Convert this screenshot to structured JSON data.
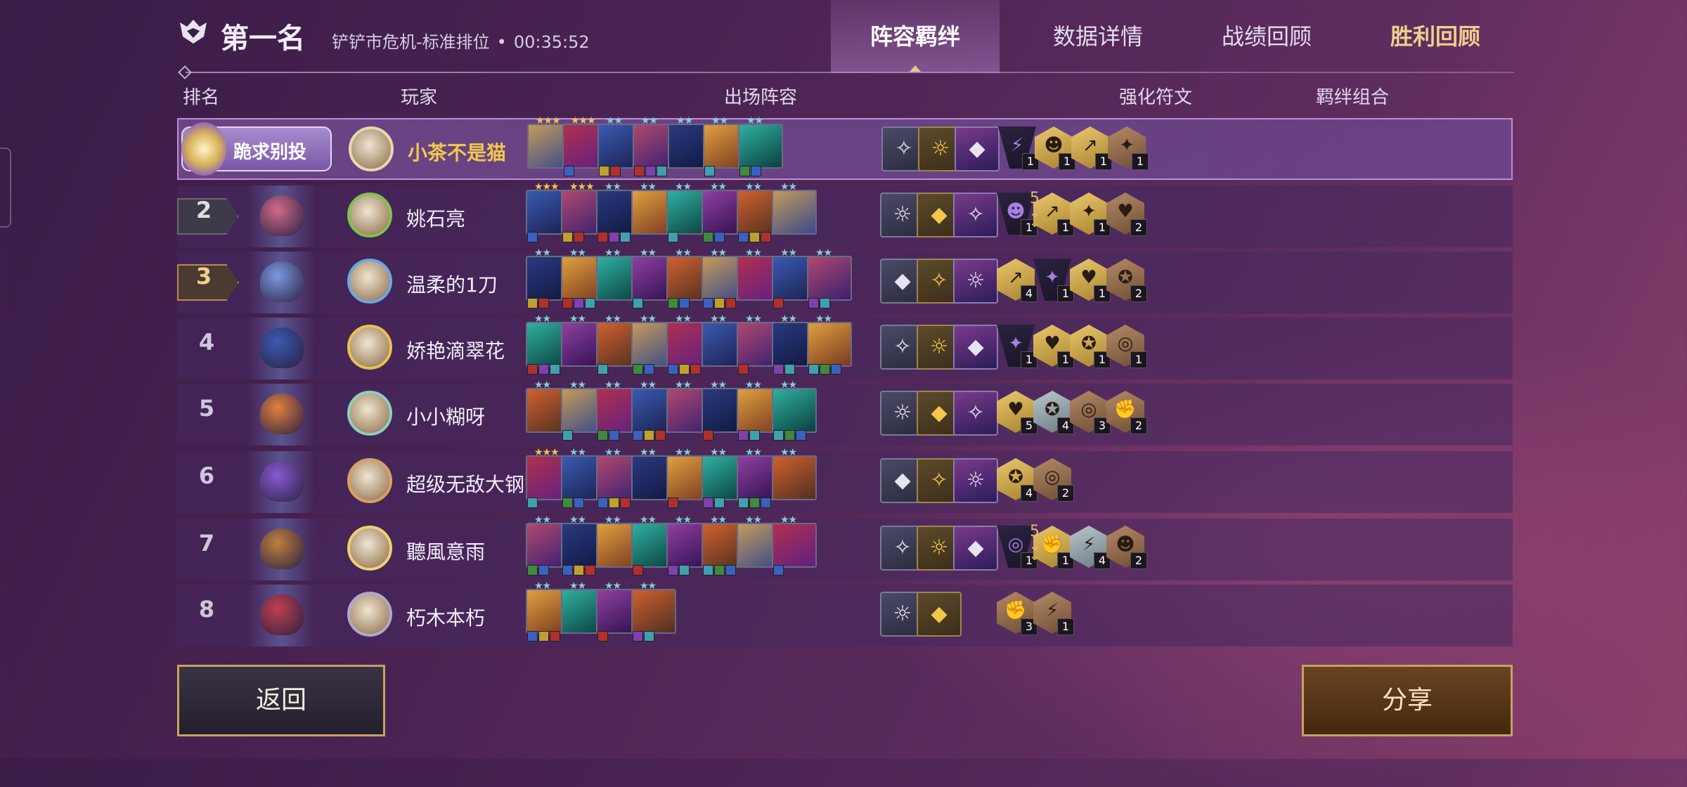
{
  "header": {
    "placement_title": "第一名",
    "mode": "铲铲市危机-标准排位",
    "separator": "•",
    "duration": "00:35:52",
    "tabs": [
      "阵容羁绊",
      "数据详情",
      "战绩回顾",
      "胜利回顾"
    ],
    "active_tab": "阵容羁绊"
  },
  "columns": {
    "rank": "排名",
    "player": "玩家",
    "lineup": "出场阵容",
    "augments": "强化符文",
    "traits": "羁绊组合"
  },
  "first_place_label": "跪求别投",
  "players": [
    {
      "rank": "1",
      "name": "小茶不是猫",
      "unit_count": 7,
      "unit_stars": [
        3,
        3,
        2,
        2,
        2,
        2,
        2
      ],
      "trait_counts": [
        "1",
        "1",
        "1",
        "1"
      ],
      "more": ""
    },
    {
      "rank": "2",
      "name": "姚石亮",
      "unit_count": 8,
      "unit_stars": [
        3,
        3,
        2,
        2,
        2,
        2,
        2,
        2
      ],
      "trait_counts": [
        "1",
        "1",
        "1",
        "2"
      ],
      "more": "5"
    },
    {
      "rank": "3",
      "name": "温柔的1刀",
      "unit_count": 9,
      "unit_stars": [
        2,
        2,
        2,
        2,
        2,
        2,
        2,
        2,
        2
      ],
      "trait_counts": [
        "4",
        "1",
        "1",
        "2"
      ],
      "more": ""
    },
    {
      "rank": "4",
      "name": "娇艳滴翠花",
      "unit_count": 9,
      "unit_stars": [
        2,
        2,
        2,
        2,
        2,
        2,
        2,
        2,
        2
      ],
      "trait_counts": [
        "1",
        "1",
        "1",
        "1"
      ],
      "more": ""
    },
    {
      "rank": "5",
      "name": "小小糊呀",
      "unit_count": 8,
      "unit_stars": [
        2,
        2,
        2,
        2,
        2,
        2,
        2,
        2
      ],
      "trait_counts": [
        "5",
        "4",
        "3",
        "2"
      ],
      "more": ""
    },
    {
      "rank": "6",
      "name": "超级无敌大钢管",
      "unit_count": 8,
      "unit_stars": [
        3,
        2,
        2,
        2,
        2,
        2,
        2,
        2
      ],
      "trait_counts": [
        "4",
        "2"
      ],
      "more": ""
    },
    {
      "rank": "7",
      "name": "聽風意雨",
      "unit_count": 8,
      "unit_stars": [
        2,
        2,
        2,
        2,
        2,
        2,
        2,
        2
      ],
      "trait_counts": [
        "1",
        "1",
        "4",
        "2"
      ],
      "more": "5"
    },
    {
      "rank": "8",
      "name": "朽木本朽",
      "unit_count": 4,
      "unit_stars": [
        2,
        2,
        2,
        2
      ],
      "trait_counts": [
        "3",
        "1"
      ],
      "more": ""
    }
  ],
  "buttons": {
    "back": "返回",
    "share": "分享"
  },
  "colors": {
    "accent_gold": "#f1c84c",
    "panel": "#462860",
    "highlight_border": "#b98fd6"
  }
}
